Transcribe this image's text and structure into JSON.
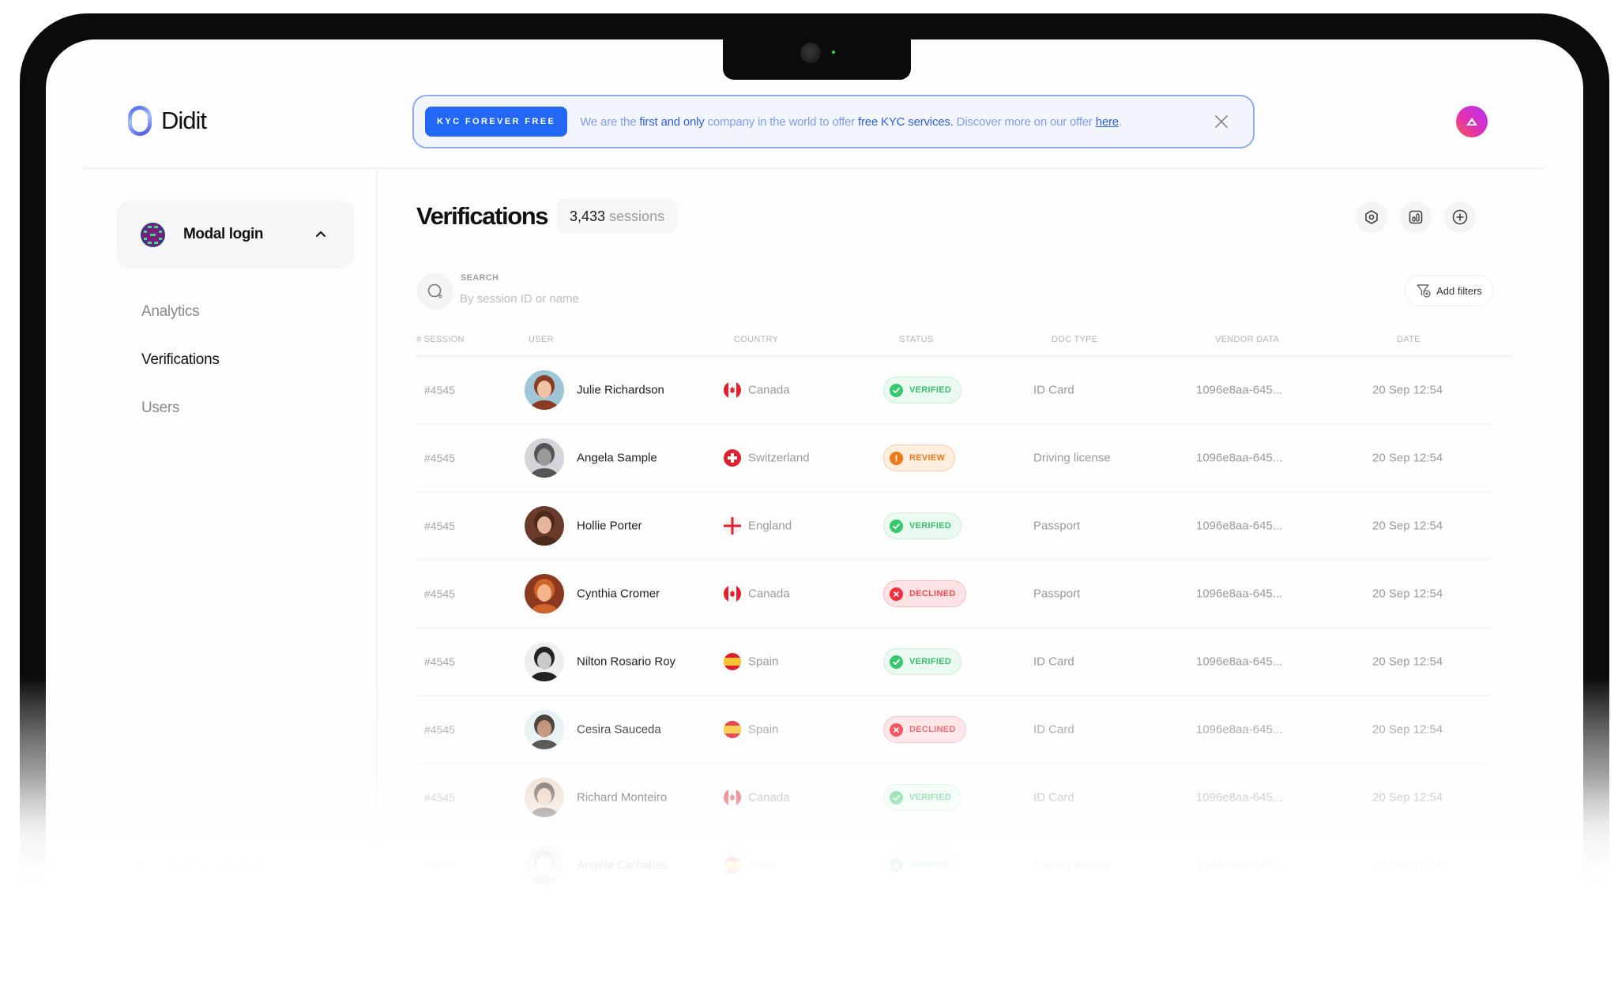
{
  "app": {
    "name": "Didit"
  },
  "banner": {
    "tag": "KYC FOREVER FREE",
    "parts": {
      "p1": "We are the ",
      "p2": "first and only",
      "p3": " company in the world to offer ",
      "p4": "free KYC services.",
      "p5": " Discover more on our offer ",
      "link": "here",
      "p6": "."
    },
    "accent_color": "#2367f6"
  },
  "sidebar": {
    "project": {
      "name": "Modal login"
    },
    "items": [
      {
        "label": "Analytics",
        "active": false
      },
      {
        "label": "Verifications",
        "active": true
      },
      {
        "label": "Users",
        "active": false
      }
    ],
    "footer": {
      "label": "Getting started"
    }
  },
  "main": {
    "title": "Verifications",
    "count": {
      "value": "3,433",
      "unit": "sessions"
    },
    "actions": [
      {
        "icon": "settings-hexagon-icon"
      },
      {
        "icon": "bar-chart-icon"
      },
      {
        "icon": "plus-circle-icon"
      }
    ],
    "search": {
      "label": "SEARCH",
      "placeholder": "By session ID or name",
      "value": ""
    },
    "add_filters": "Add filters"
  },
  "table": {
    "columns": [
      "# SESSION",
      "USER",
      "COUNTRY",
      "STATUS",
      "DOC TYPE",
      "VENDOR DATA",
      "DATE"
    ],
    "rows": [
      {
        "session": "#4545",
        "user": "Julie Richardson",
        "country": "Canada",
        "status": "VERIFIED",
        "doc_type": "ID Card",
        "vendor": "1096e8aa-645...",
        "date": "20 Sep 12:54"
      },
      {
        "session": "#4545",
        "user": "Angela Sample",
        "country": "Switzerland",
        "status": "REVIEW",
        "doc_type": "Driving license",
        "vendor": "1096e8aa-645...",
        "date": "20 Sep 12:54"
      },
      {
        "session": "#4545",
        "user": "Hollie Porter",
        "country": "England",
        "status": "VERIFIED",
        "doc_type": "Passport",
        "vendor": "1096e8aa-645...",
        "date": "20 Sep 12:54"
      },
      {
        "session": "#4545",
        "user": "Cynthia Cromer",
        "country": "Canada",
        "status": "DECLINED",
        "doc_type": "Passport",
        "vendor": "1096e8aa-645...",
        "date": "20 Sep 12:54"
      },
      {
        "session": "#4545",
        "user": "Nilton Rosario Roy",
        "country": "Spain",
        "status": "VERIFIED",
        "doc_type": "ID Card",
        "vendor": "1096e8aa-645...",
        "date": "20 Sep 12:54"
      },
      {
        "session": "#4545",
        "user": "Cesira Sauceda",
        "country": "Spain",
        "status": "DECLINED",
        "doc_type": "ID Card",
        "vendor": "1096e8aa-645...",
        "date": "20 Sep 12:54"
      },
      {
        "session": "#4545",
        "user": "Richard Monteiro",
        "country": "Canada",
        "status": "VERIFIED",
        "doc_type": "ID Card",
        "vendor": "1096e8aa-645...",
        "date": "20 Sep 12:54"
      },
      {
        "session": "#4545",
        "user": "Angela Carballes",
        "country": "Spain",
        "status": "VERIFIED",
        "doc_type": "Driving license",
        "vendor": "1096e8aa-645...",
        "date": "20 Sep 12:54"
      }
    ]
  },
  "status_colors": {
    "VERIFIED": "#35c06a",
    "REVIEW": "#e87b1b",
    "DECLINED": "#ee4a55"
  }
}
